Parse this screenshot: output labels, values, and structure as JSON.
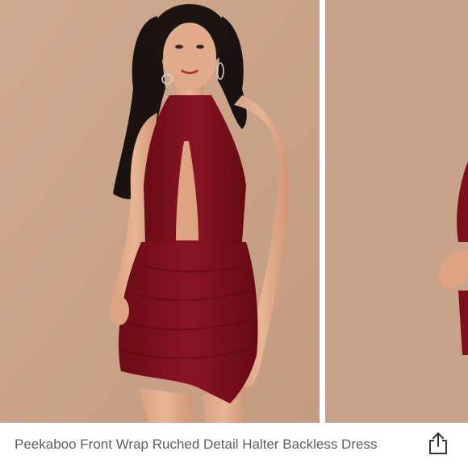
{
  "listing": {
    "title": "Peekaboo Front Wrap Ruched Detail Halter Backless Dress"
  },
  "gallery": {
    "photos": [
      {
        "description_icon": "model-photo-front"
      },
      {
        "description_icon": "model-photo-side"
      }
    ]
  },
  "actions": {
    "share_icon": "share-icon"
  },
  "colors": {
    "background": "#c9a389",
    "dress": "#7b0f1c",
    "text": "#5e5e5e"
  }
}
